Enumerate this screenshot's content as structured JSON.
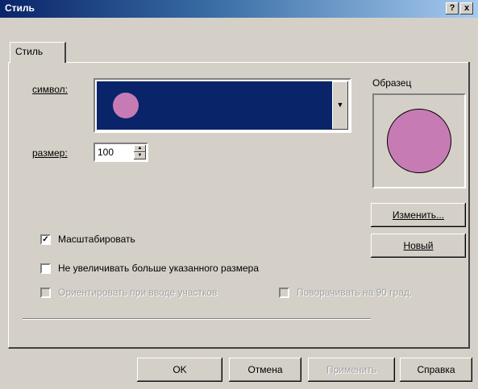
{
  "window": {
    "title": "Стиль",
    "help_glyph": "?",
    "close_glyph": "x"
  },
  "tabs": [
    {
      "label": "Стиль"
    }
  ],
  "symbol": {
    "label": "символ:",
    "swatch_color": "#c77bb5",
    "selected_bg": "#0a246a",
    "dropdown_glyph": "▼"
  },
  "size": {
    "label": "размер:",
    "value": "100",
    "up_glyph": "▲",
    "down_glyph": "▼"
  },
  "sample": {
    "label": "Образец",
    "color": "#c77bb5"
  },
  "buttons": {
    "change": "Изменить...",
    "new": "Новый",
    "ok": "OK",
    "cancel": "Отмена",
    "apply": "Применить",
    "help": "Справка"
  },
  "checkboxes": [
    {
      "label": "Масштабировать",
      "checked": true,
      "enabled": true,
      "mark": "✓"
    },
    {
      "label": "Не увеличивать больше указанного размера",
      "checked": false,
      "enabled": true
    },
    {
      "label": "Ориентировать при вводе участков",
      "checked": false,
      "enabled": false
    },
    {
      "label": "Поворачивать на 90 град.",
      "checked": false,
      "enabled": false
    }
  ]
}
